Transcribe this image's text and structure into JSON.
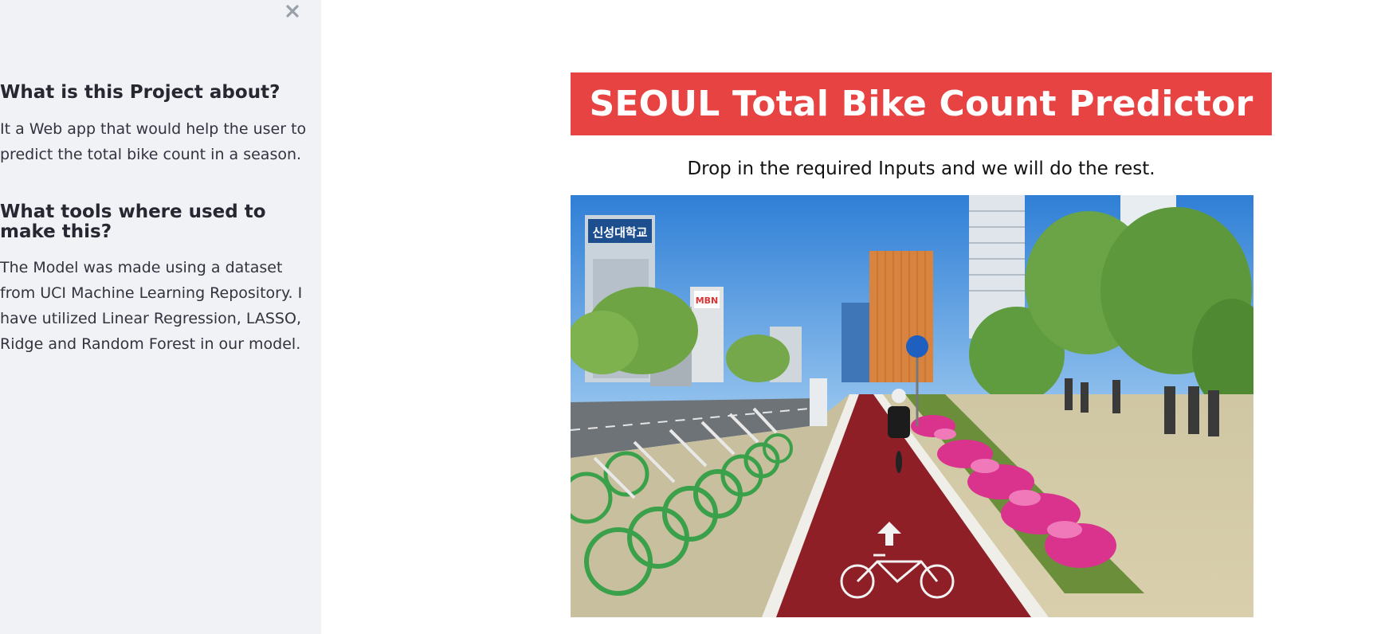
{
  "sidebar": {
    "close_icon": "close-icon",
    "about": {
      "heading": "What is this Project about?",
      "text": "It a Web app that would help the user to predict the total bike count in a season."
    },
    "tools": {
      "heading": "What tools where used to make this?",
      "text": "The Model was made using a dataset from UCI Machine Learning Repository. I have utilized Linear Regression, LASSO, Ridge and Random Forest in our model."
    }
  },
  "main": {
    "title": "SEOUL Total Bike Count Predictor",
    "subtitle": "Drop in the required Inputs and we will do the rest.",
    "image": {
      "building_sign": "신성대학교",
      "billboard": "MBN"
    }
  },
  "colors": {
    "sidebar_bg": "#f0f2f6",
    "banner": "#e74343",
    "bike_lane": "#8e1f27"
  }
}
